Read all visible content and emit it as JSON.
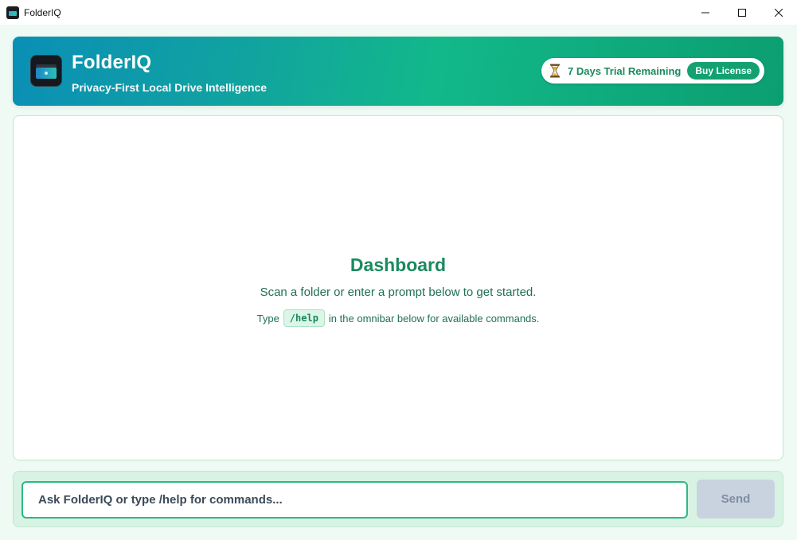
{
  "window": {
    "title": "FolderIQ"
  },
  "header": {
    "brand_name": "FolderIQ",
    "tagline": "Privacy-First Local Drive Intelligence",
    "trial_text": "7 Days Trial Remaining",
    "buy_label": "Buy License"
  },
  "dashboard": {
    "title": "Dashboard",
    "subtitle": "Scan a folder or enter a prompt below to get started.",
    "hint_prefix": "Type",
    "hint_command": "/help",
    "hint_suffix": "in the omnibar below for available commands."
  },
  "omnibar": {
    "placeholder": "Ask FolderIQ or type /help for commands...",
    "value": "",
    "send_label": "Send"
  },
  "colors": {
    "accent": "#13a172",
    "header_gradient_start": "#0a8fb6",
    "header_gradient_end": "#0b9e70",
    "text_green": "#1a8a5e",
    "send_disabled": "#c9d3df"
  }
}
